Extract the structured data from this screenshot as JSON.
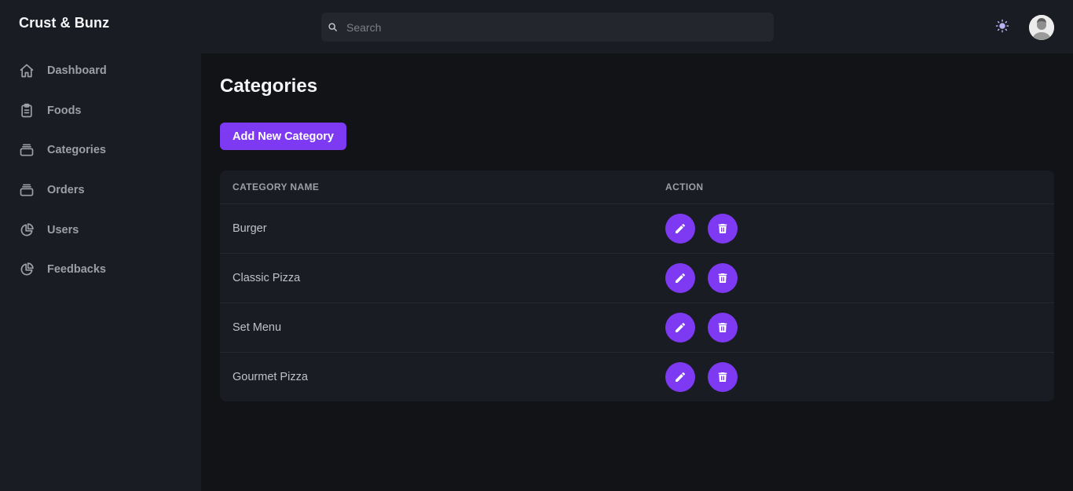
{
  "brand": "Crust & Bunz",
  "sidebar": {
    "items": [
      {
        "label": "Dashboard",
        "icon": "home-icon"
      },
      {
        "label": "Foods",
        "icon": "clipboard-icon"
      },
      {
        "label": "Categories",
        "icon": "tray-icon"
      },
      {
        "label": "Orders",
        "icon": "tray-icon"
      },
      {
        "label": "Users",
        "icon": "pie-chart-icon"
      },
      {
        "label": "Feedbacks",
        "icon": "pie-chart-icon"
      }
    ]
  },
  "header": {
    "search_placeholder": "Search",
    "search_value": "",
    "theme_icon": "sun-icon",
    "avatar": "user-avatar"
  },
  "main": {
    "title": "Categories",
    "add_button": "Add New Category",
    "table": {
      "columns": [
        "CATEGORY NAME",
        "ACTION"
      ],
      "rows": [
        {
          "name": "Burger"
        },
        {
          "name": "Classic Pizza"
        },
        {
          "name": "Set Menu"
        },
        {
          "name": "Gourmet Pizza"
        }
      ],
      "row_actions": [
        "edit-icon",
        "trash-icon"
      ]
    }
  },
  "colors": {
    "accent": "#7e3af2",
    "sidebar_bg": "#1a1c23",
    "page_bg": "#121317"
  }
}
